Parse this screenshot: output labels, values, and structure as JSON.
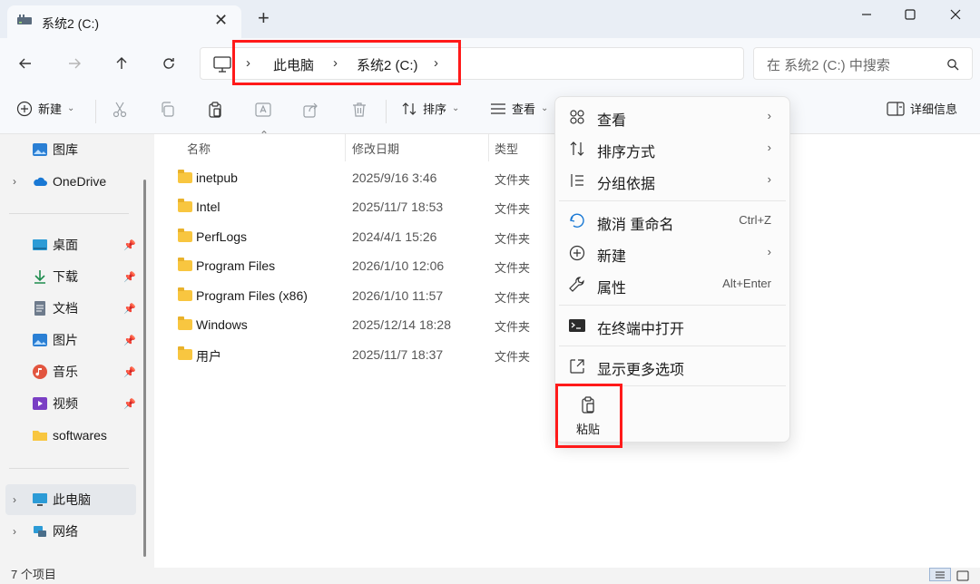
{
  "window": {
    "tab_title": "系统2 (C:)",
    "new_tab": "+",
    "close_tab": "✕"
  },
  "nav": {
    "breadcrumb": [
      "此电脑",
      "系统2 (C:)"
    ],
    "search_placeholder": "在 系统2 (C:) 中搜索"
  },
  "toolbar": {
    "new_label": "新建",
    "sort_label": "排序",
    "view_label": "查看",
    "details_label": "详细信息"
  },
  "sidebar": {
    "top_items": [
      {
        "label": "图库",
        "icon": "gallery-icon"
      },
      {
        "label": "OneDrive",
        "icon": "cloud-icon"
      }
    ],
    "pinned": [
      {
        "label": "桌面",
        "icon": "desktop-icon"
      },
      {
        "label": "下载",
        "icon": "download-icon"
      },
      {
        "label": "文档",
        "icon": "document-icon"
      },
      {
        "label": "图片",
        "icon": "pictures-icon"
      },
      {
        "label": "音乐",
        "icon": "music-icon"
      },
      {
        "label": "视频",
        "icon": "video-icon"
      },
      {
        "label": "softwares",
        "icon": "folder-icon"
      }
    ],
    "bottom_items": [
      {
        "label": "此电脑",
        "icon": "pc-icon"
      },
      {
        "label": "网络",
        "icon": "network-icon"
      }
    ]
  },
  "columns": {
    "name": "名称",
    "date": "修改日期",
    "type": "类型"
  },
  "files": [
    {
      "name": "inetpub",
      "date": "2025/9/16 3:46",
      "type": "文件夹"
    },
    {
      "name": "Intel",
      "date": "2025/11/7 18:53",
      "type": "文件夹"
    },
    {
      "name": "PerfLogs",
      "date": "2024/4/1 15:26",
      "type": "文件夹"
    },
    {
      "name": "Program Files",
      "date": "2026/1/10 12:06",
      "type": "文件夹"
    },
    {
      "name": "Program Files (x86)",
      "date": "2026/1/10 11:57",
      "type": "文件夹"
    },
    {
      "name": "Windows",
      "date": "2025/12/14 18:28",
      "type": "文件夹"
    },
    {
      "name": "用户",
      "date": "2025/11/7 18:37",
      "type": "文件夹"
    }
  ],
  "status": {
    "count_text": "7 个项目"
  },
  "context_menu": {
    "view": "查看",
    "sort_by": "排序方式",
    "group_by": "分组依据",
    "undo": "撤消 重命名",
    "undo_shortcut": "Ctrl+Z",
    "new": "新建",
    "properties": "属性",
    "properties_shortcut": "Alt+Enter",
    "open_terminal": "在终端中打开",
    "more_options": "显示更多选项",
    "paste": "粘贴"
  },
  "colors": {
    "highlight": "#ff1a1a",
    "accent": "#0067c0",
    "folder": "#f8c640"
  }
}
